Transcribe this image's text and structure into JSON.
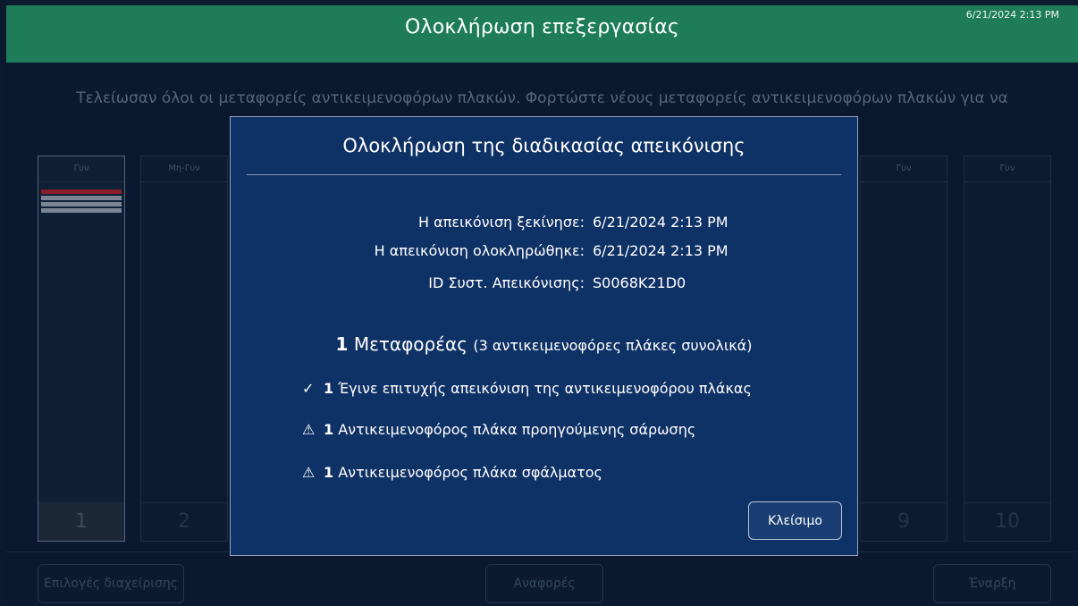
{
  "header": {
    "title": "Ολοκλήρωση επεξεργασίας",
    "datetime": "6/21/2024 2:13 PM"
  },
  "background": {
    "message": "Τελείωσαν όλοι οι μεταφορείς αντικειμενοφόρων πλακών. Φορτώστε νέους μεταφορείς αντικειμενοφόρων πλακών για να",
    "carriers": [
      {
        "label": "Γυν",
        "number": "1"
      },
      {
        "label": "Μη-Γυν",
        "number": "2"
      },
      {
        "label": "Γυν",
        "number": "9"
      },
      {
        "label": "Γυν",
        "number": "10"
      }
    ],
    "plate_colors": [
      "#8b1e2b",
      "#7b8595",
      "#7b8595",
      "#7b8595"
    ]
  },
  "bottom_bar": {
    "admin_options": "Επιλογές διαχείρισης",
    "reports": "Αναφορές",
    "start": "Έναρξη"
  },
  "modal": {
    "title": "Ολοκλήρωση της διαδικασίας απεικόνισης",
    "info": [
      {
        "key": "Η απεικόνιση ξεκίνησε:",
        "value": "6/21/2024 2:13 PM"
      },
      {
        "key": "Η απεικόνιση ολοκληρώθηκε:",
        "value": "6/21/2024 2:13 PM"
      },
      {
        "key": "ID Συστ. Απεικόνισης:",
        "value": "S0068K21D0"
      }
    ],
    "summary": {
      "count": "1",
      "label": "Μεταφορέας",
      "detail": "(3 αντικειμενοφόρες πλάκες συνολικά)"
    },
    "results": [
      {
        "icon": "check-icon",
        "symbol": "✓",
        "count": "1",
        "text": "Έγινε επιτυχής απεικόνιση της αντικειμενοφόρου πλάκας"
      },
      {
        "icon": "warning-icon",
        "symbol": "⚠",
        "count": "1",
        "text": "Αντικειμενοφόρος πλάκα προηγούμενης σάρωσης"
      },
      {
        "icon": "warning-icon",
        "symbol": "⚠",
        "count": "1",
        "text": "Αντικειμενοφόρος πλάκα σφάλματος"
      }
    ],
    "close_label": "Κλείσιμο"
  },
  "colors": {
    "header_bg": "#1e7d58",
    "app_bg": "#0a1930",
    "modal_bg": "#0f3266",
    "modal_border": "#8ea1bd"
  }
}
